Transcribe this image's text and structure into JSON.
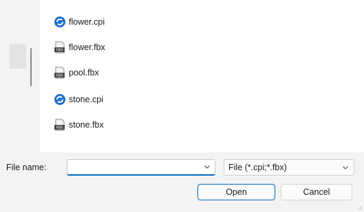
{
  "files": [
    {
      "name": "flower.cpi",
      "icon": "cpi-file-icon"
    },
    {
      "name": "flower.fbx",
      "icon": "fbx-file-icon"
    },
    {
      "name": "pool.fbx",
      "icon": "fbx-file-icon"
    },
    {
      "name": "stone.cpi",
      "icon": "cpi-file-icon"
    },
    {
      "name": "stone.fbx",
      "icon": "fbx-file-icon"
    }
  ],
  "filename": {
    "label": "File name:",
    "value": ""
  },
  "filter": {
    "selected": "File (*.cpi;*.fbx)"
  },
  "buttons": {
    "open": "Open",
    "cancel": "Cancel"
  },
  "icon_text": {
    "fbx": "FBX"
  },
  "colors": {
    "accent": "#0067c0",
    "cpi_icon": "#1e6fd9"
  }
}
